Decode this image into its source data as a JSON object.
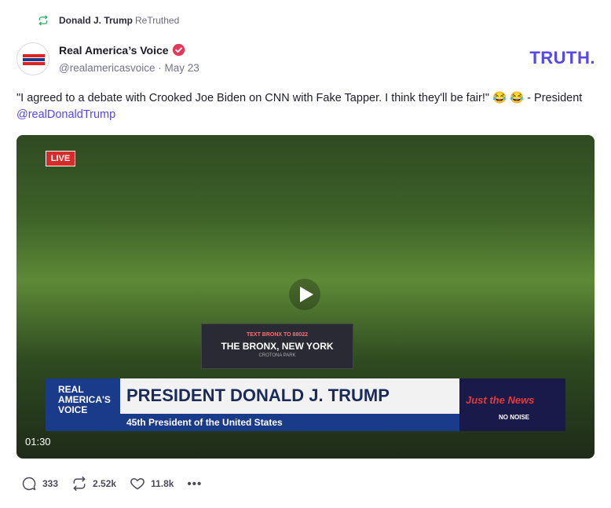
{
  "retruth": {
    "user": "Donald J. Trump",
    "label": "ReTruthed",
    "icon": "retruth-icon"
  },
  "author": {
    "display_name": "Real America’s Voice",
    "handle": "@realamericasvoice",
    "date": "May 23",
    "avatar_text": "REAL AMERICA'S VOICE",
    "verified_color": "#e6385d"
  },
  "brand": {
    "logo_text": "TRUTH.",
    "color": "#5448ee"
  },
  "post": {
    "text": "\"I agreed to a debate with Crooked Joe Biden on CNN with Fake Tapper. I think they'll be fair!\" 😂 😂 - President ",
    "mention": "@realDonaldTrump"
  },
  "video": {
    "live_badge": "LIVE",
    "duration": "01:30",
    "podium_top": "TEXT BRONX TO 88022",
    "podium_main": "THE BRONX, NEW YORK",
    "podium_sub": "CROTONA PARK",
    "chyron_logo": "REAL AMERICA'S VOICE",
    "chyron_title": "PRESIDENT DONALD J. TRUMP",
    "chyron_subtitle": "45th President of the United States",
    "chyron_brand": "Just the News",
    "chyron_tag": "NO NOISE"
  },
  "actions": {
    "replies": "333",
    "retruths": "2.52k",
    "likes": "11.8k",
    "more_label": "•••"
  }
}
